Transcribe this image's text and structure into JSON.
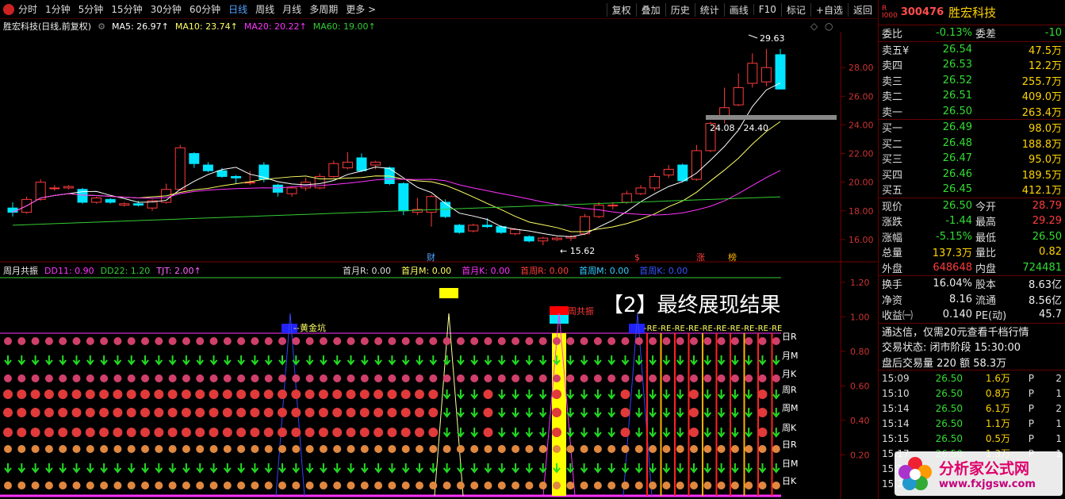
{
  "toolbar": {
    "periods": [
      "分时",
      "1分钟",
      "5分钟",
      "15分钟",
      "30分钟",
      "60分钟",
      "日线",
      "周线",
      "月线",
      "多周期",
      "更多 >"
    ],
    "active_period": "日线",
    "actions": [
      "复权",
      "叠加",
      "历史",
      "统计",
      "画线",
      "F10",
      "标记",
      "+自选",
      "返回"
    ]
  },
  "main_legend": {
    "title": "胜宏科技(日线,前复权)",
    "ma5": "MA5: 26.97↑",
    "ma10": "MA10: 23.74↑",
    "ma20": "MA20: 20.22↑",
    "ma60": "MA60: 19.00↑"
  },
  "sub_legend": {
    "title": "周月共振",
    "dd11": "DD11: 0.90",
    "dd22": "DD22: 1.20",
    "tjt": "TJT: 2.00↑",
    "right_items": [
      "首月R: 0.00",
      "首月M: 0.00",
      "首月K: 0.00",
      "首周R: 0.00",
      "首周M: 0.00",
      "首周K: 0.00"
    ]
  },
  "price_axis": [
    "28.00",
    "26.00",
    "24.00",
    "22.00",
    "20.00",
    "18.00",
    "16.00"
  ],
  "sub_axis": [
    "1.20",
    "1.00",
    "0.80",
    "0.60",
    "0.40",
    "0.20"
  ],
  "annotations": {
    "high": "29.63",
    "low": "15.62",
    "range": "24.08 - 24.40",
    "cai": "财",
    "s": "$",
    "zhang": "涨",
    "bang": "榜",
    "huangjinkeng": "黄金坑",
    "zhougongzhen": "周共振",
    "repeat_tag": "-RE",
    "row_labels": [
      "日R",
      "月M",
      "月K",
      "周R",
      "周M",
      "周K",
      "日R",
      "日M",
      "日K"
    ]
  },
  "caption": "【2】最终展现结果",
  "quote": {
    "code": "300476",
    "name": "胜宏科技",
    "r_badge": "R\nI000",
    "weibi": {
      "label": "委比",
      "value": "-0.13%",
      "label2": "委差",
      "value2": "-10"
    },
    "sells": [
      {
        "label": "卖五",
        "mark": "¥",
        "price": "26.54",
        "vol": "47.5万"
      },
      {
        "label": "卖四",
        "mark": "",
        "price": "26.53",
        "vol": "12.2万"
      },
      {
        "label": "卖三",
        "mark": "",
        "price": "26.52",
        "vol": "255.7万"
      },
      {
        "label": "卖二",
        "mark": "",
        "price": "26.51",
        "vol": "409.0万"
      },
      {
        "label": "卖一",
        "mark": "",
        "price": "26.50",
        "vol": "263.4万"
      }
    ],
    "buys": [
      {
        "label": "买一",
        "price": "26.49",
        "vol": "98.0万"
      },
      {
        "label": "买二",
        "price": "26.48",
        "vol": "188.8万"
      },
      {
        "label": "买三",
        "price": "26.47",
        "vol": "95.0万"
      },
      {
        "label": "买四",
        "price": "26.46",
        "vol": "189.5万"
      },
      {
        "label": "买五",
        "price": "26.45",
        "vol": "412.1万"
      }
    ],
    "stats": [
      {
        "l": "现价",
        "v": "26.50",
        "vc": "green",
        "l2": "今开",
        "v2": "28.79",
        "v2c": "red"
      },
      {
        "l": "涨跌",
        "v": "-1.44",
        "vc": "green",
        "l2": "最高",
        "v2": "29.29",
        "v2c": "red"
      },
      {
        "l": "涨幅",
        "v": "-5.15%",
        "vc": "green",
        "l2": "最低",
        "v2": "26.50",
        "v2c": "green"
      },
      {
        "l": "总量",
        "v": "137.3万",
        "vc": "yellow",
        "l2": "量比",
        "v2": "0.82",
        "v2c": "yellow"
      },
      {
        "l": "外盘",
        "v": "648648",
        "vc": "red",
        "l2": "内盘",
        "v2": "724481",
        "v2c": "green"
      }
    ],
    "stats2": [
      {
        "l": "换手",
        "v": "16.04%",
        "vc": "white",
        "l2": "股本",
        "v2": "8.63亿",
        "v2c": "white"
      },
      {
        "l": "净资",
        "v": "8.16",
        "vc": "white",
        "l2": "流通",
        "v2": "8.56亿",
        "v2c": "white"
      },
      {
        "l": "收益㈠",
        "v": "0.140",
        "vc": "white",
        "l2": "PE(动)",
        "v2": "45.7",
        "v2c": "white"
      }
    ],
    "promo": "通达信，仅需20元查看千档行情",
    "status": "交易状态: 闭市阶段 15:30:00",
    "after": "盘后交易量 220 额 58.3万",
    "ticks": [
      {
        "t": "15:09",
        "p": "26.50",
        "v": "1.6万",
        "bs": "P",
        "n": "2"
      },
      {
        "t": "15:10",
        "p": "26.50",
        "v": "0.8万",
        "bs": "P",
        "n": "1"
      },
      {
        "t": "15:14",
        "p": "26.50",
        "v": "6.1万",
        "bs": "P",
        "n": "2"
      },
      {
        "t": "15:14",
        "p": "26.50",
        "v": "1.1万",
        "bs": "P",
        "n": "1"
      },
      {
        "t": "15:15",
        "p": "26.50",
        "v": "0.5万",
        "bs": "P",
        "n": "1"
      },
      {
        "t": "15:17",
        "p": "26.50",
        "v": "1.3万",
        "bs": "P",
        "n": "1"
      },
      {
        "t": "15:2",
        "p": "",
        "v": "",
        "bs": "",
        "n": ""
      },
      {
        "t": "15:2",
        "p": "",
        "v": "",
        "bs": "",
        "n": ""
      }
    ]
  },
  "watermark": {
    "main": "分析家公式网",
    "url": "www.fxjgsw.com"
  },
  "colors": {
    "up": "#ff3b3b",
    "down": "#00e5ff",
    "ma5": "#ffffff",
    "ma10": "#ffff66",
    "ma20": "#ff33ff",
    "ma60": "#33cc33",
    "bg": "#000000"
  },
  "chart_data": {
    "type": "candlestick",
    "title": "胜宏科技(日线,前复权)",
    "candles": [
      [
        18.2,
        17.9,
        18.6,
        17.6
      ],
      [
        17.9,
        18.8,
        19.0,
        17.8
      ],
      [
        18.8,
        20.0,
        20.2,
        18.7
      ],
      [
        19.6,
        19.6,
        19.8,
        19.4
      ],
      [
        19.6,
        19.7,
        19.8,
        19.5
      ],
      [
        19.5,
        18.6,
        19.6,
        18.5
      ],
      [
        18.6,
        18.9,
        19.0,
        18.5
      ],
      [
        18.8,
        18.6,
        18.9,
        18.5
      ],
      [
        18.4,
        18.5,
        18.6,
        18.3
      ],
      [
        18.5,
        18.4,
        18.7,
        18.3
      ],
      [
        18.2,
        18.7,
        18.8,
        18.0
      ],
      [
        18.6,
        19.5,
        19.9,
        18.5
      ],
      [
        19.5,
        22.4,
        22.6,
        19.4
      ],
      [
        22.0,
        21.3,
        22.1,
        21.0
      ],
      [
        21.2,
        20.8,
        21.4,
        20.7
      ],
      [
        20.8,
        20.4,
        21.0,
        20.3
      ],
      [
        20.4,
        20.3,
        20.5,
        19.9
      ],
      [
        20.0,
        20.0,
        20.8,
        19.8
      ],
      [
        21.2,
        20.2,
        21.4,
        20.0
      ],
      [
        19.8,
        19.3,
        19.9,
        19.0
      ],
      [
        19.2,
        19.6,
        19.7,
        19.0
      ],
      [
        19.6,
        20.0,
        20.3,
        19.4
      ],
      [
        19.6,
        20.4,
        20.6,
        19.5
      ],
      [
        20.4,
        21.3,
        21.5,
        20.3
      ],
      [
        21.0,
        21.4,
        22.1,
        20.9
      ],
      [
        21.7,
        20.8,
        22.0,
        20.7
      ],
      [
        21.2,
        21.4,
        21.5,
        20.9
      ],
      [
        21.0,
        19.9,
        21.1,
        19.8
      ],
      [
        19.9,
        18.0,
        20.0,
        17.7
      ],
      [
        17.9,
        18.1,
        18.9,
        17.7
      ],
      [
        17.9,
        19.0,
        19.1,
        16.9
      ],
      [
        18.6,
        17.6,
        18.8,
        17.5
      ],
      [
        17.0,
        16.5,
        17.1,
        16.4
      ],
      [
        16.6,
        17.0,
        17.1,
        16.5
      ],
      [
        17.0,
        16.9,
        17.5,
        16.8
      ],
      [
        16.9,
        16.5,
        17.0,
        16.4
      ],
      [
        16.4,
        16.7,
        16.8,
        16.3
      ],
      [
        16.2,
        15.9,
        16.3,
        15.8
      ],
      [
        15.9,
        16.1,
        16.2,
        15.6
      ],
      [
        16.0,
        16.1,
        16.2,
        15.9
      ],
      [
        16.1,
        16.2,
        16.3,
        15.9
      ],
      [
        16.4,
        17.6,
        17.8,
        16.3
      ],
      [
        17.6,
        18.4,
        18.6,
        17.5
      ],
      [
        18.4,
        18.4,
        18.6,
        18.1
      ],
      [
        18.6,
        19.2,
        19.4,
        18.5
      ],
      [
        19.2,
        19.6,
        19.8,
        19.1
      ],
      [
        19.6,
        20.4,
        20.6,
        19.4
      ],
      [
        20.5,
        20.9,
        21.2,
        20.3
      ],
      [
        21.2,
        20.1,
        21.3,
        20.0
      ],
      [
        20.2,
        22.2,
        22.6,
        20.1
      ],
      [
        22.2,
        24.1,
        24.2,
        22.1
      ],
      [
        24.6,
        25.2,
        26.6,
        24.1
      ],
      [
        25.4,
        26.6,
        27.6,
        25.3
      ],
      [
        26.9,
        28.3,
        29.0,
        26.6
      ],
      [
        27.0,
        28.0,
        29.3,
        26.7
      ],
      [
        28.9,
        26.5,
        29.3,
        26.5
      ]
    ]
  }
}
